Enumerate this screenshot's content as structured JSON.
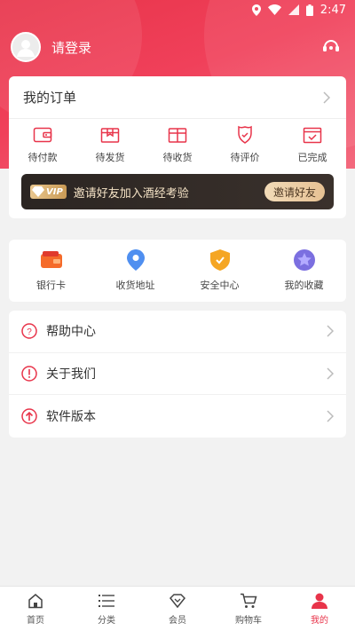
{
  "status_bar": {
    "time": "2:47"
  },
  "header": {
    "login_text": "请登录"
  },
  "orders": {
    "title": "我的订单",
    "items": [
      {
        "label": "待付款",
        "icon": "wallet-icon"
      },
      {
        "label": "待发货",
        "icon": "box-icon"
      },
      {
        "label": "待收货",
        "icon": "package-icon"
      },
      {
        "label": "待评价",
        "icon": "review-icon"
      },
      {
        "label": "已完成",
        "icon": "completed-icon"
      }
    ]
  },
  "vip": {
    "badge": "VIP",
    "text": "邀请好友加入酒经考验",
    "button": "邀请好友"
  },
  "tools": {
    "items": [
      {
        "label": "银行卡",
        "icon": "bank-card-icon"
      },
      {
        "label": "收货地址",
        "icon": "location-icon"
      },
      {
        "label": "安全中心",
        "icon": "shield-icon"
      },
      {
        "label": "我的收藏",
        "icon": "star-icon"
      }
    ]
  },
  "menu": {
    "items": [
      {
        "label": "帮助中心",
        "icon": "help-icon"
      },
      {
        "label": "关于我们",
        "icon": "info-icon"
      },
      {
        "label": "软件版本",
        "icon": "version-icon"
      }
    ]
  },
  "tabbar": {
    "items": [
      {
        "label": "首页",
        "icon": "home-icon"
      },
      {
        "label": "分类",
        "icon": "category-icon"
      },
      {
        "label": "会员",
        "icon": "member-icon"
      },
      {
        "label": "购物车",
        "icon": "cart-icon"
      },
      {
        "label": "我的",
        "icon": "profile-icon"
      }
    ],
    "active": "我的"
  },
  "colors": {
    "accent": "#e8344a",
    "vip_gold": "#e6c193",
    "background": "#f2f2f2"
  }
}
